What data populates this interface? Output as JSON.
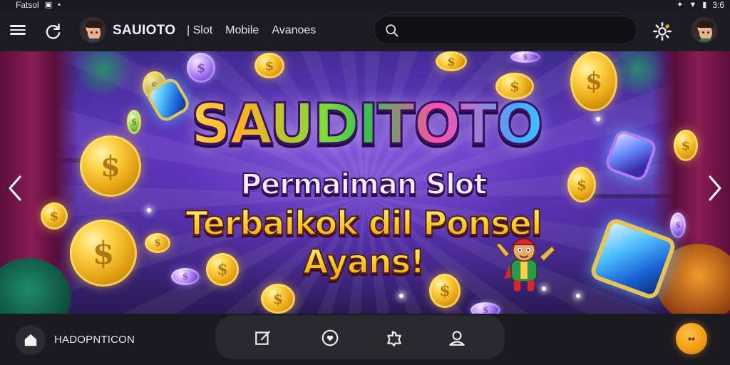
{
  "status_bar": {
    "left_text": "Fatsol",
    "right_time": "3:6"
  },
  "header": {
    "brand": "SAUIOTO",
    "nav": [
      "| Slot",
      "Mobile",
      "Avanoes"
    ],
    "search": {
      "placeholder": ""
    }
  },
  "hero": {
    "title": "SAUDITOTO",
    "line1": "Permaiman Slot",
    "line2": "Terbaikok dil Ponsel",
    "line3": "Ayans!"
  },
  "bottom_bar": {
    "home_label": "HADOPNTICON",
    "fab_label": "••",
    "dock_icons": [
      "edit-icon",
      "heart-circle-icon",
      "puzzle-icon",
      "user-icon"
    ]
  },
  "colors": {
    "nav_bg": "#1c1a22",
    "hero_purple": "#5a35b8",
    "accent_orange": "#f29a12",
    "title_gradient": [
      "#ffe14d",
      "#7bdc3a",
      "#ff4fa8",
      "#46a8ff"
    ]
  }
}
